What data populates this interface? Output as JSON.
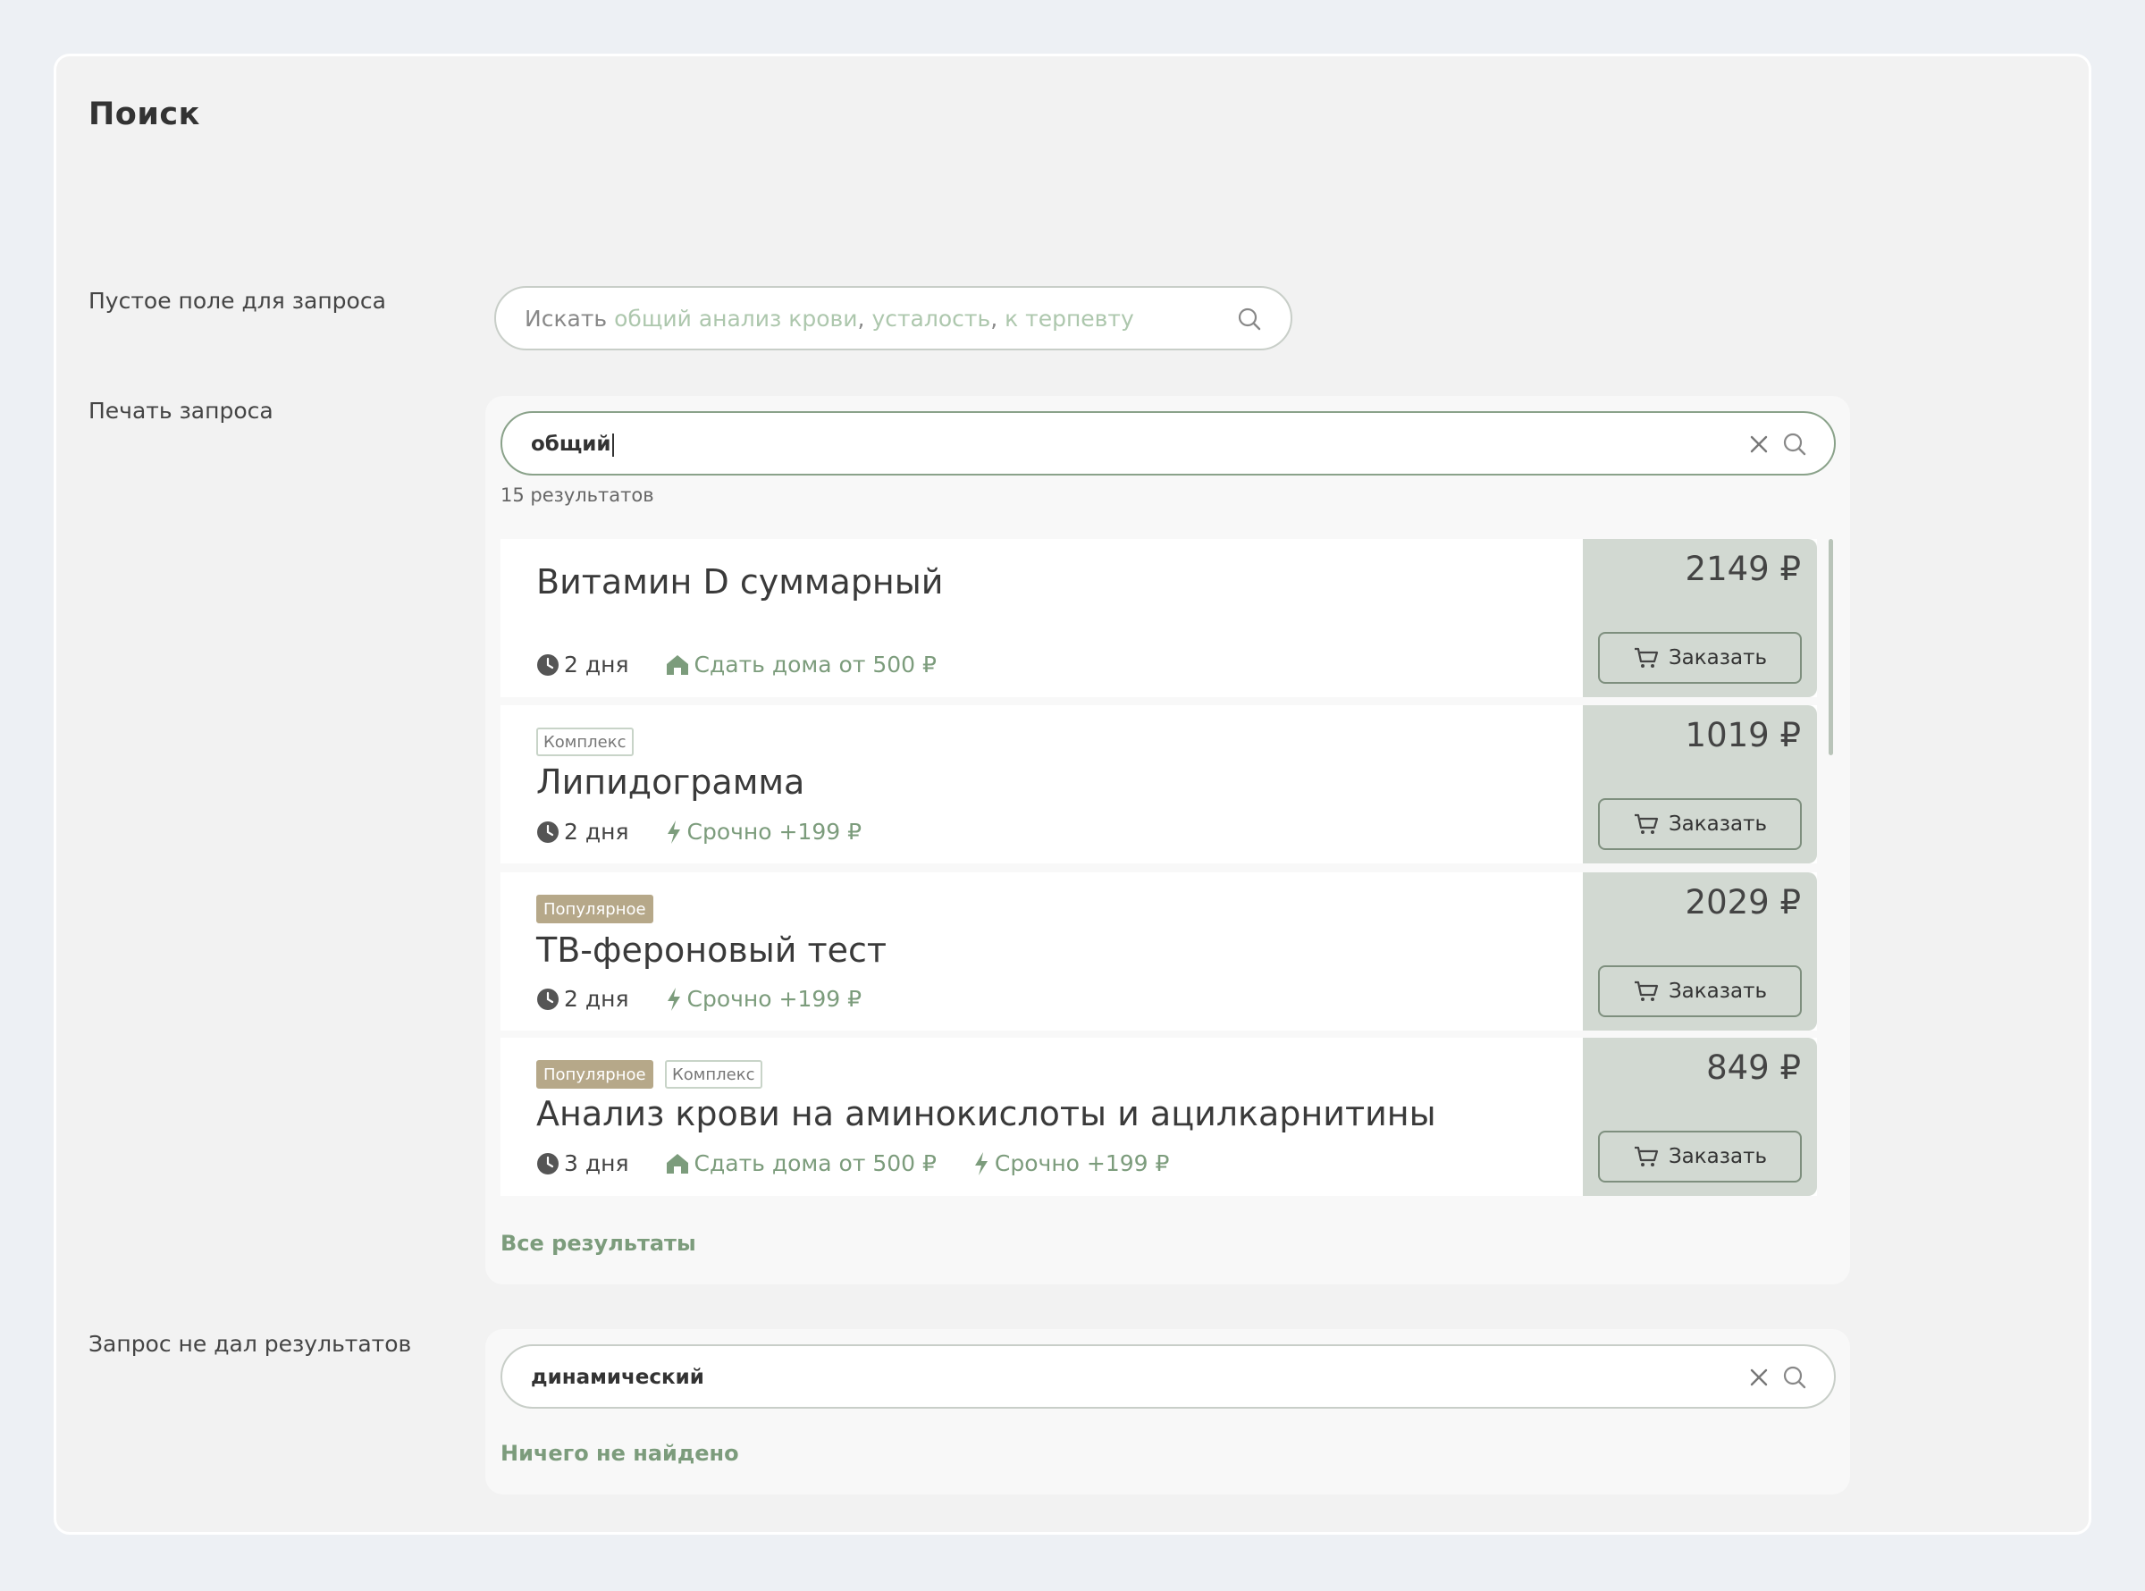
{
  "page": {
    "title": "Поиск"
  },
  "sections": {
    "empty": {
      "label": "Пустое поле для запроса",
      "placeholder": {
        "prefix": "Искать",
        "hint_1": "общий анализ крови",
        "hint_2": "усталость",
        "hint_3": "к терпевту",
        "separator": ","
      }
    },
    "typing": {
      "label": "Печать запроса",
      "query": "общий",
      "result_count": "15 результатов",
      "results": [
        {
          "title": "Витамин D суммарный",
          "badges": [],
          "days": "2 дня",
          "home": "Сдать дома от 500 ₽",
          "urgent": "",
          "price": "2149 ₽",
          "order": "Заказать"
        },
        {
          "title": "Липидограмма",
          "badges": [
            "Комплекс"
          ],
          "days": "2 дня",
          "home": "",
          "urgent": "Срочно +199 ₽",
          "price": "1019 ₽",
          "order": "Заказать"
        },
        {
          "title": "ТВ-фероновый тест",
          "badges": [
            "Популярное"
          ],
          "days": "2 дня",
          "home": "",
          "urgent": "Срочно +199 ₽",
          "price": "2029 ₽",
          "order": "Заказать"
        },
        {
          "title": "Анализ крови на аминокислоты и ацилкарнитины",
          "badges": [
            "Популярное",
            "Комплекс"
          ],
          "days": "3 дня",
          "home": "Сдать дома от 500 ₽",
          "urgent": "Срочно +199 ₽",
          "price": "849 ₽",
          "order": "Заказать"
        }
      ],
      "all_results": "Все результаты"
    },
    "no_results": {
      "label": "Запрос не дал результатов",
      "query": "динамический",
      "message": "Ничего не найдено"
    }
  },
  "icons": {
    "search": "search-icon",
    "clear": "close-icon",
    "clock": "clock-icon",
    "home": "home-icon",
    "urgent": "lightning-icon",
    "cart": "cart-icon"
  },
  "colors": {
    "accent_green": "#7c9c7c",
    "price_bg": "#d2d9d2",
    "popular_badge": "#b6a889",
    "page_bg": "#edf0f4"
  }
}
